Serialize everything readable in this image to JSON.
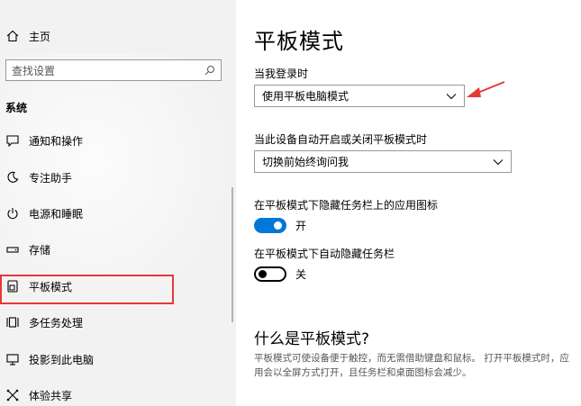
{
  "sidebar": {
    "home_label": "主页",
    "search_placeholder": "查找设置",
    "section_title": "系统",
    "items": [
      {
        "label": "通知和操作",
        "icon": "notification-icon"
      },
      {
        "label": "专注助手",
        "icon": "moon-icon"
      },
      {
        "label": "电源和睡眠",
        "icon": "power-icon"
      },
      {
        "label": "存储",
        "icon": "storage-icon"
      },
      {
        "label": "平板模式",
        "icon": "tablet-icon"
      },
      {
        "label": "多任务处理",
        "icon": "multitask-icon"
      },
      {
        "label": "投影到此电脑",
        "icon": "project-icon"
      },
      {
        "label": "体验共享",
        "icon": "share-icon"
      }
    ],
    "selected_index": 4
  },
  "main": {
    "title": "平板模式",
    "login_label": "当我登录时",
    "login_value": "使用平板电脑模式",
    "auto_label": "当此设备自动开启或关闭平板模式时",
    "auto_value": "切换前始终询问我",
    "hide_icons_label": "在平板模式下隐藏任务栏上的应用图标",
    "hide_icons_state": "开",
    "hide_icons_on": true,
    "auto_hide_label": "在平板模式下自动隐藏任务栏",
    "auto_hide_state": "关",
    "auto_hide_on": false,
    "what_is_title": "什么是平板模式?",
    "what_is_desc": "平板模式可使设备便于触控，而无需借助键盘和鼠标。 打开平板模式时，应用会以全屏方式打开，且任务栏和桌面图标会减少。"
  },
  "colors": {
    "accent": "#0078d7",
    "highlight": "#e53935",
    "annotation_arrow": "#e53935"
  }
}
